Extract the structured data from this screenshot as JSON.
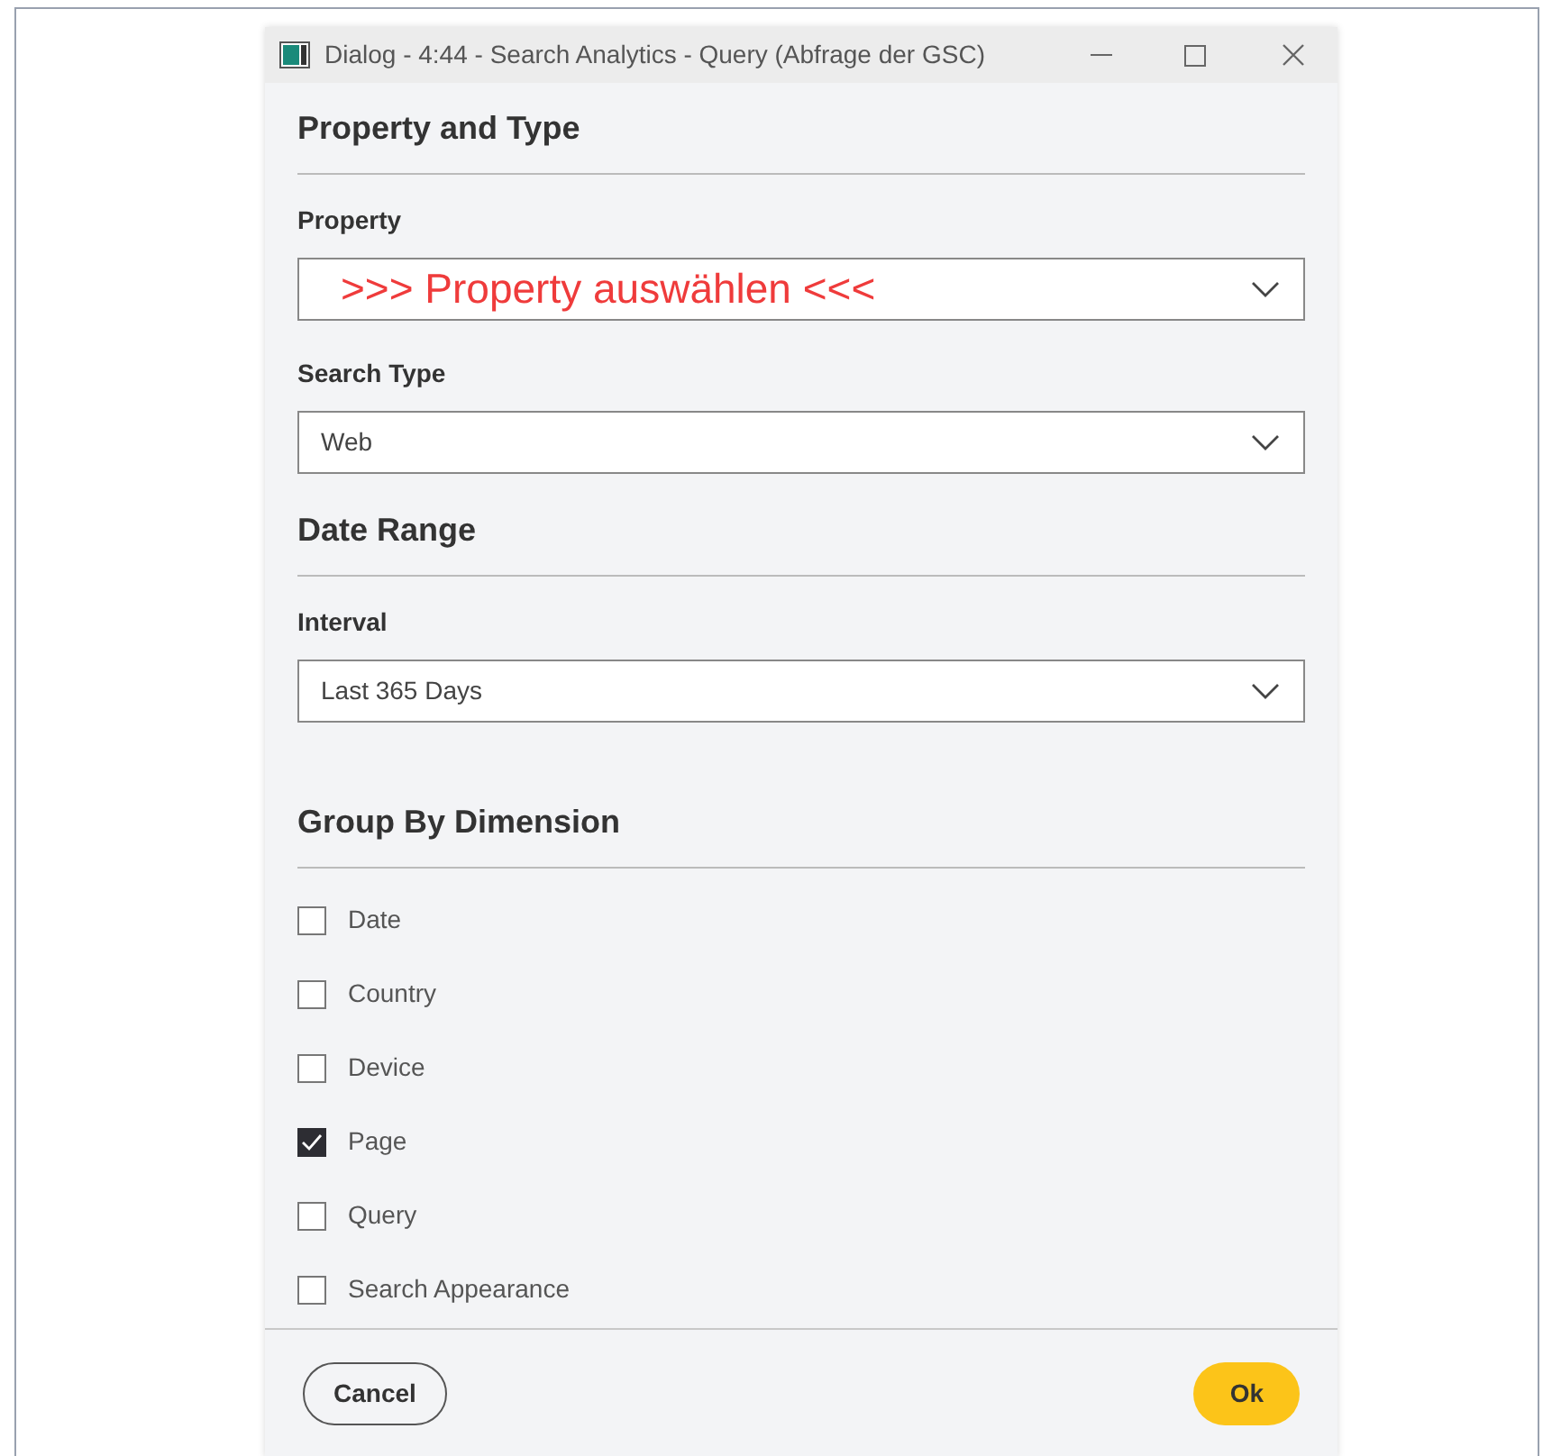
{
  "window": {
    "title": "Dialog - 4:44 - Search Analytics - Query (Abfrage der GSC)"
  },
  "sections": [
    {
      "heading": "Property and Type",
      "fields": [
        {
          "label": "Property",
          "placeholder": ">>> Property auswählen <<<"
        },
        {
          "label": "Search Type",
          "value": "Web"
        }
      ]
    },
    {
      "heading": "Date Range",
      "fields": [
        {
          "label": "Interval",
          "value": "Last 365 Days"
        }
      ]
    },
    {
      "heading": "Group By Dimension",
      "checkboxes": [
        {
          "label": "Date",
          "checked": false
        },
        {
          "label": "Country",
          "checked": false
        },
        {
          "label": "Device",
          "checked": false
        },
        {
          "label": "Page",
          "checked": true
        },
        {
          "label": "Query",
          "checked": false
        },
        {
          "label": "Search Appearance",
          "checked": false
        }
      ]
    }
  ],
  "buttons": [
    {
      "label": "Cancel",
      "kind": "secondary"
    },
    {
      "label": "Ok",
      "kind": "primary"
    }
  ]
}
